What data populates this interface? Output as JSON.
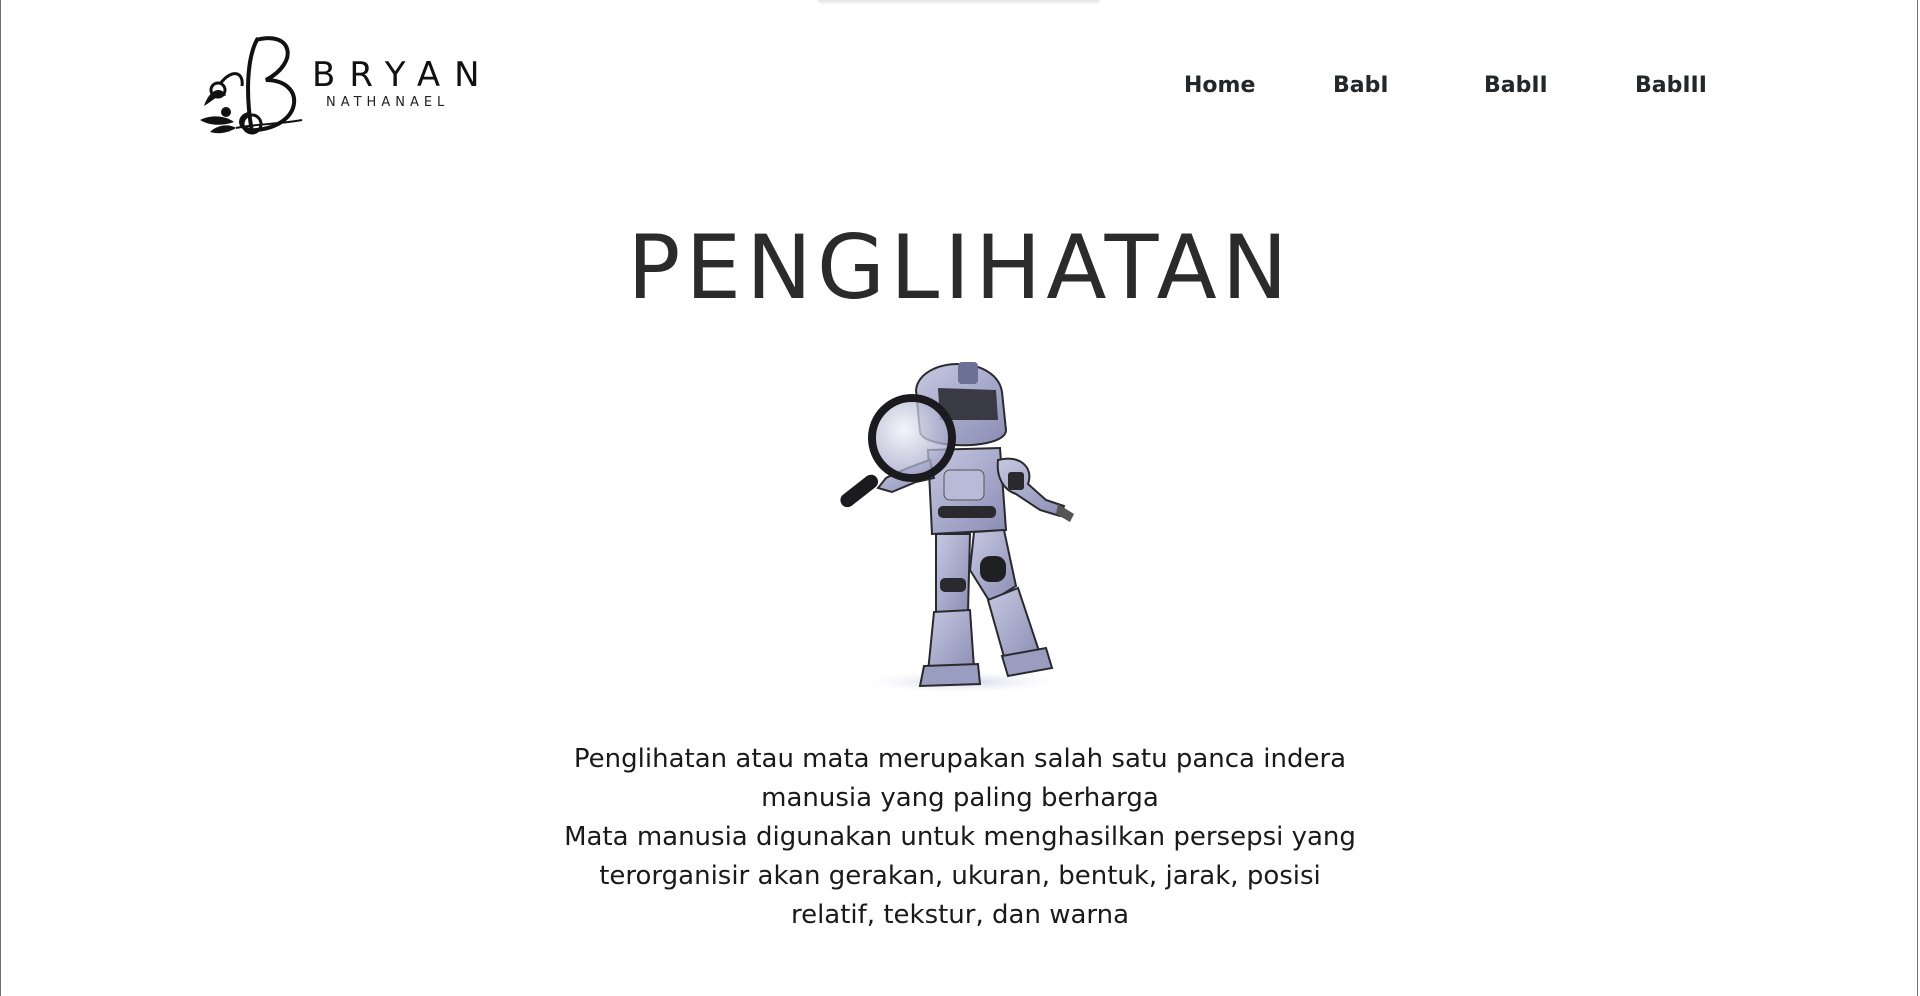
{
  "header": {
    "logo": {
      "name": "BRYAN",
      "subtitle": "NATHANAEL"
    },
    "nav": {
      "items": [
        {
          "label": "Home"
        },
        {
          "label": "BabI"
        },
        {
          "label": "BabII"
        },
        {
          "label": "BabIII"
        }
      ]
    }
  },
  "main": {
    "title": "PENGLIHATAN",
    "hero_image_icon": "robot-with-magnifying-glass",
    "paragraphs": [
      "Penglihatan atau mata merupakan salah satu panca indera manusia yang paling berharga",
      "Mata manusia digunakan untuk menghasilkan persepsi yang terorganisir akan gerakan, ukuran, bentuk, jarak, posisi relatif, tekstur, dan warna"
    ]
  },
  "colors": {
    "background": "#ffffff",
    "text": "#1f1f1f",
    "nav_text": "#22272b",
    "robot_body": "#a3a6c8",
    "robot_dark": "#2a2a2e"
  }
}
